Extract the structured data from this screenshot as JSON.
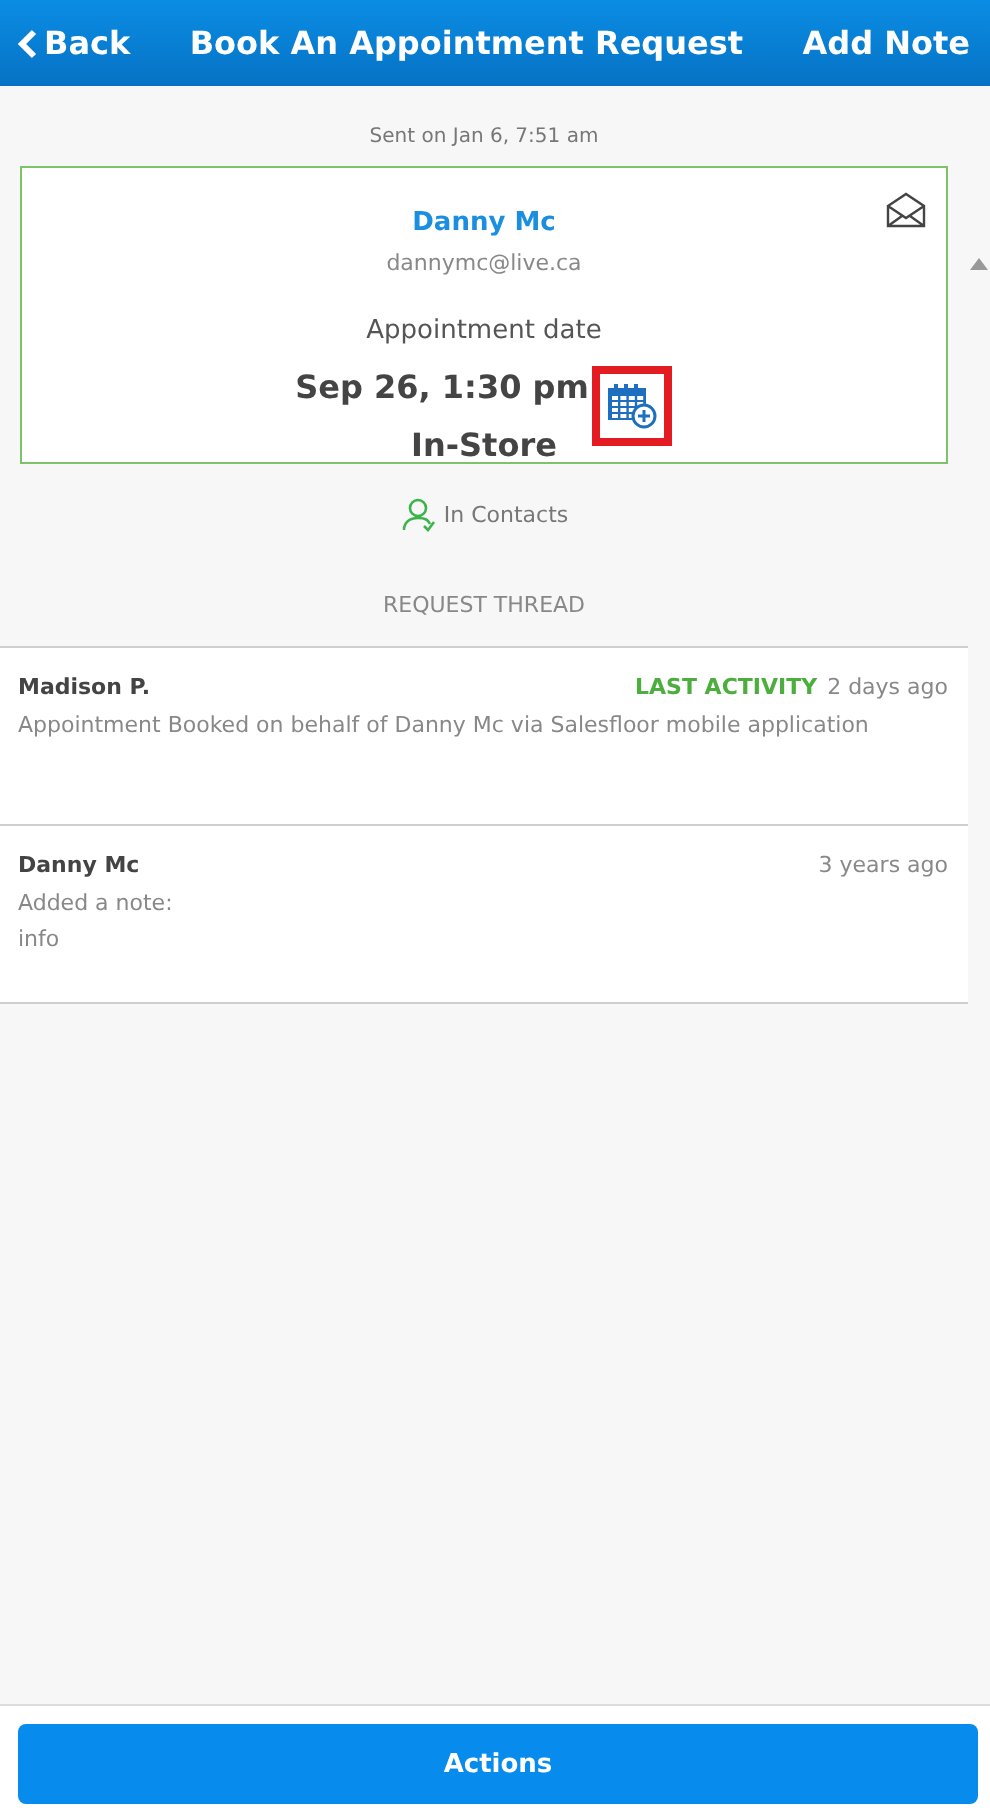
{
  "header": {
    "back": "Back",
    "title": "Book An Appointment Request",
    "action": "Add Note"
  },
  "sent": "Sent on Jan 6, 7:51 am",
  "card": {
    "name": "Danny Mc",
    "email": "dannymc@live.ca",
    "date_label": "Appointment date",
    "date": "Sep 26, 1:30 pm",
    "location": "In-Store",
    "calendar_highlighted": true
  },
  "contact_status": "In Contacts",
  "thread_title": "REQUEST THREAD",
  "thread": [
    {
      "author": "Madison P.",
      "badge": "LAST ACTIVITY",
      "time": "2 days ago",
      "lines": [
        "Appointment Booked on behalf of Danny Mc via Salesfloor mobile application"
      ]
    },
    {
      "author": "Danny Mc",
      "time": "3 years ago",
      "lines": [
        "Added a note:",
        "info"
      ]
    }
  ],
  "actions": "Actions"
}
